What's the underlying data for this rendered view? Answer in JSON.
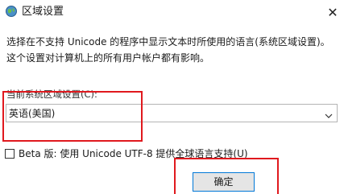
{
  "window": {
    "title": "区域设置",
    "close_glyph": "✕",
    "icon": "globe-icon"
  },
  "description": "选择在不支持 Unicode 的程序中显示文本时所使用的语言(系统区域设置)。这个设置对计算机上的所有用户帐户都有影响。",
  "current_locale": {
    "label": "当前系统区域设置(C):",
    "selected_value": "英语(美国)"
  },
  "beta_option": {
    "label": "Beta 版: 使用 Unicode UTF-8 提供全球语言支持(U)",
    "checked": false
  },
  "buttons": {
    "ok_label": "确定"
  },
  "colors": {
    "highlight": "#e0191e",
    "ok_border": "#0078d7"
  }
}
